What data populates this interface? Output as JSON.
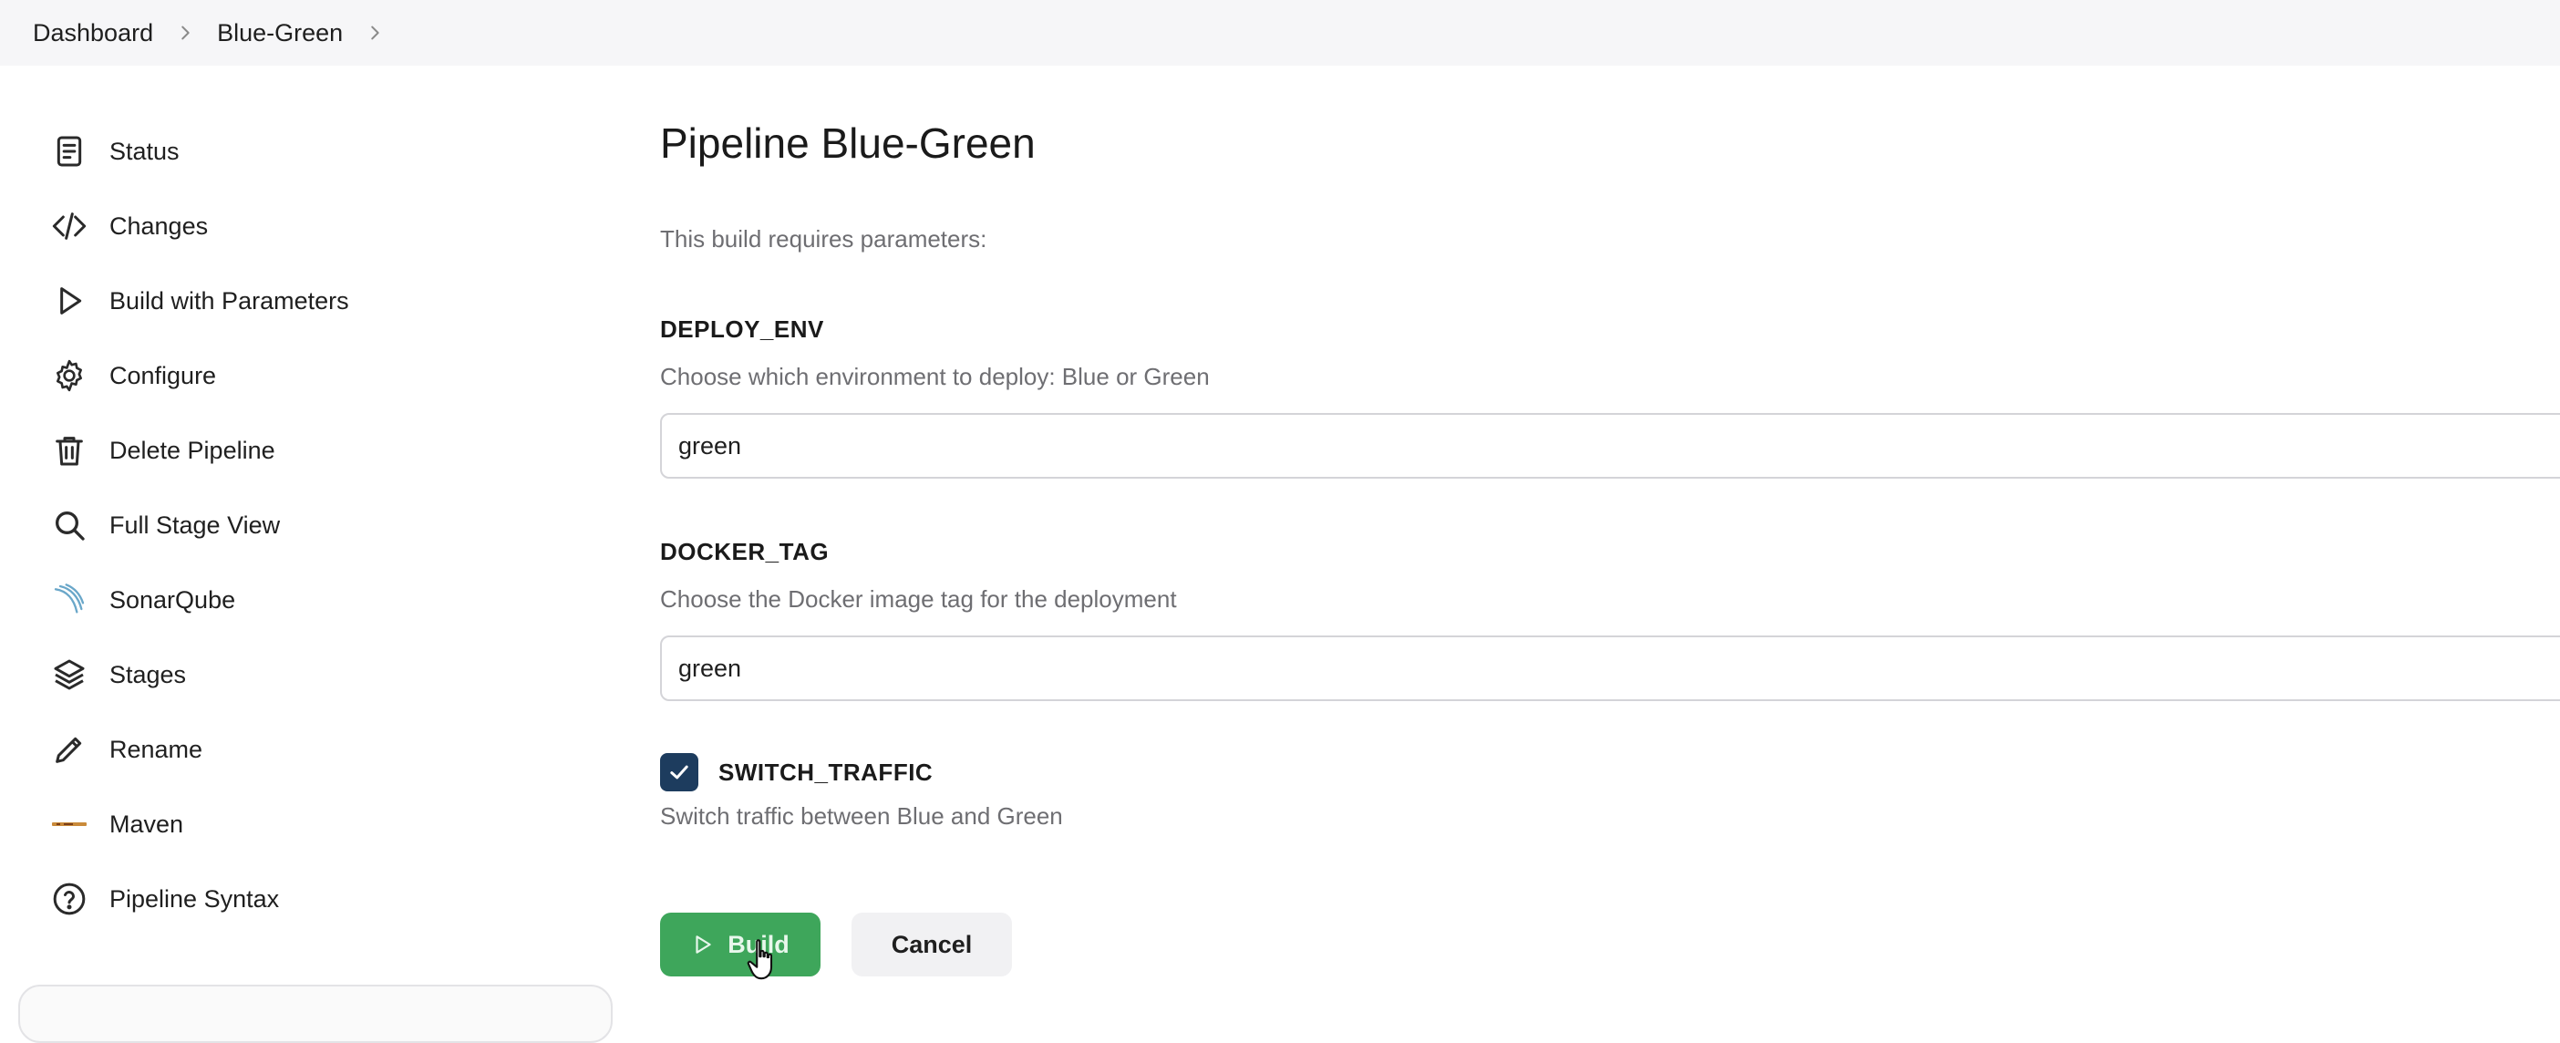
{
  "breadcrumb": {
    "items": [
      "Dashboard",
      "Blue-Green"
    ]
  },
  "sidebar": {
    "items": [
      {
        "label": "Status",
        "icon": "document-icon"
      },
      {
        "label": "Changes",
        "icon": "code-icon"
      },
      {
        "label": "Build with Parameters",
        "icon": "play-icon"
      },
      {
        "label": "Configure",
        "icon": "gear-icon"
      },
      {
        "label": "Delete Pipeline",
        "icon": "trash-icon"
      },
      {
        "label": "Full Stage View",
        "icon": "search-icon"
      },
      {
        "label": "SonarQube",
        "icon": "sonarqube-icon"
      },
      {
        "label": "Stages",
        "icon": "layers-icon"
      },
      {
        "label": "Rename",
        "icon": "pencil-icon"
      },
      {
        "label": "Maven",
        "icon": "maven-icon"
      },
      {
        "label": "Pipeline Syntax",
        "icon": "help-icon"
      }
    ]
  },
  "main": {
    "title": "Pipeline Blue-Green",
    "intro": "This build requires parameters:",
    "params": [
      {
        "name": "DEPLOY_ENV",
        "description": "Choose which environment to deploy: Blue or Green",
        "value": "green"
      },
      {
        "name": "DOCKER_TAG",
        "description": "Choose the Docker image tag for the deployment",
        "value": "green"
      }
    ],
    "switch": {
      "name": "SWITCH_TRAFFIC",
      "description": "Switch traffic between Blue and Green",
      "checked": true
    },
    "build_label": "Build",
    "cancel_label": "Cancel"
  },
  "colors": {
    "build_button": "#3ea65b",
    "checkbox": "#1d3c5e"
  }
}
